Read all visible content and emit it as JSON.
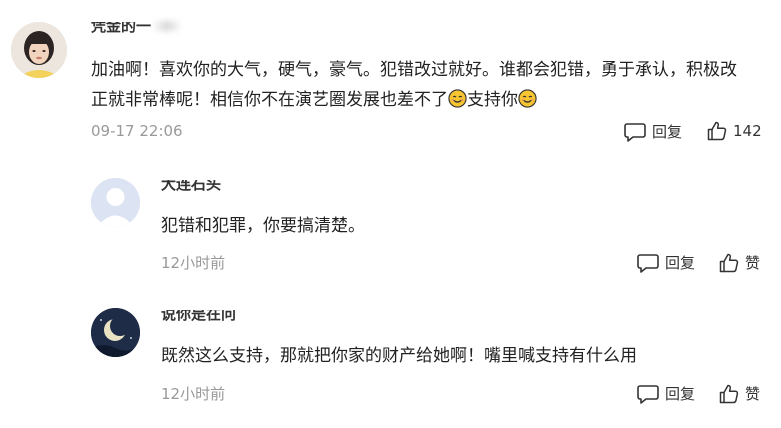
{
  "comments": [
    {
      "author": "凭金的一",
      "text_line1": "加油啊！喜欢你的大气，硬气，豪气。犯错改过就好。谁都会犯错，勇于承认，积极改",
      "text_line2_before": "正就非常棒呢！相信你不在演艺圈发展也差不了",
      "text_line2_mid": "支持你",
      "time": "09-17 22:06",
      "reply_label": "回复",
      "like_label": "142"
    },
    {
      "author": "大连石头",
      "text": "犯错和犯罪，你要搞清楚。",
      "time": "12小时前",
      "reply_label": "回复",
      "like_label": "赞"
    },
    {
      "author": "说你是在问",
      "text": "既然这么支持，那就把你家的财产给她啊！嘴里喊支持有什么用",
      "time": "12小时前",
      "reply_label": "回复",
      "like_label": "赞"
    }
  ],
  "icons": {
    "reply": "comment-bubble-icon",
    "like": "thumbs-up-icon",
    "emoji": "smiling-face-emoji"
  },
  "colors": {
    "text": "#222222",
    "muted": "#999999",
    "emoji_fill": "#f7c531"
  }
}
